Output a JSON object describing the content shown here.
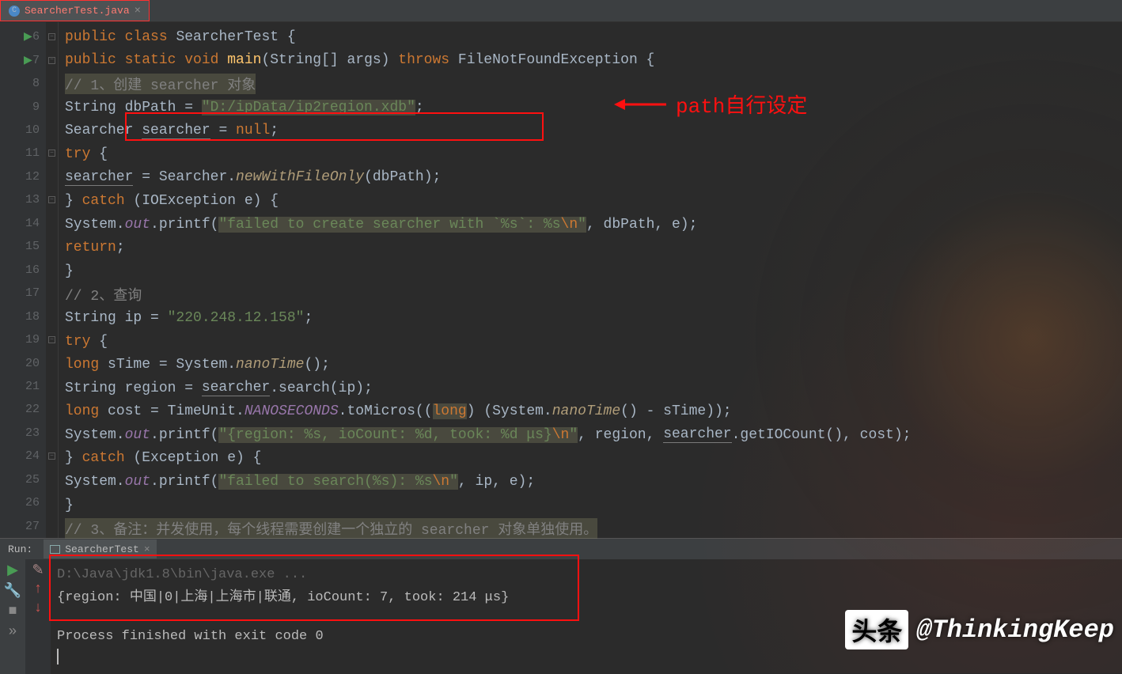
{
  "tab": {
    "filename": "SearcherTest.java"
  },
  "gutter": {
    "lines": [
      "6",
      "7",
      "8",
      "9",
      "10",
      "11",
      "12",
      "13",
      "14",
      "15",
      "16",
      "17",
      "18",
      "19",
      "20",
      "21",
      "22",
      "23",
      "24",
      "25",
      "26",
      "27"
    ]
  },
  "code": {
    "l6": {
      "kw1": "public class ",
      "name": "SearcherTest ",
      "brace": "{"
    },
    "l7": {
      "kw1": "public static void ",
      "fn": "main",
      "args": "(String[] args) ",
      "kw2": "throws ",
      "ex": "FileNotFoundException ",
      "brace": "{"
    },
    "l8": {
      "cmt": "// 1、创建 searcher 对象"
    },
    "l9": {
      "t1": "String dbPath = ",
      "str": "\"D:/ipData/ip2region.xdb\"",
      "semi": ";"
    },
    "l10": {
      "t1": "Searcher ",
      "var": "searcher",
      "t2": " = ",
      "kw": "null",
      "semi": ";"
    },
    "l11": {
      "kw": "try ",
      "brace": "{"
    },
    "l12": {
      "var": "searcher",
      "t1": " = Searcher.",
      "fn": "newWithFileOnly",
      "t2": "(dbPath);"
    },
    "l13": {
      "b1": "} ",
      "kw": "catch ",
      "t1": "(IOException e) {"
    },
    "l14": {
      "t1": "System.",
      "fld": "out",
      "t2": ".printf(",
      "str": "\"failed to create searcher with `%s`: %s",
      "esc": "\\n",
      "strend": "\"",
      "t3": ", dbPath, e);"
    },
    "l15": {
      "kw": "return",
      "semi": ";"
    },
    "l16": {
      "brace": "}"
    },
    "l17": {
      "cmt": "// 2、查询"
    },
    "l18": {
      "t1": "String ip = ",
      "str": "\"220.248.12.158\"",
      "semi": ";"
    },
    "l19": {
      "kw": "try ",
      "brace": "{"
    },
    "l20": {
      "kw": "long ",
      "t1": "sTime = System.",
      "fn": "nanoTime",
      "t2": "();"
    },
    "l21": {
      "t1": "String region = ",
      "var": "searcher",
      "t2": ".search(ip);"
    },
    "l22": {
      "kw1": "long ",
      "t1": "cost = TimeUnit.",
      "fld": "NANOSECONDS",
      "t2": ".toMicros((",
      "kw2": "long",
      "t3": ") (System.",
      "fn": "nanoTime",
      "t4": "() - sTime));"
    },
    "l23": {
      "t1": "System.",
      "fld": "out",
      "t2": ".printf(",
      "str": "\"{region: %s, ioCount: %d, took: %d μs}",
      "esc": "\\n",
      "strend": "\"",
      "t3": ", region, ",
      "var": "searcher",
      "t4": ".getIOCount(), cost);"
    },
    "l24": {
      "b1": "} ",
      "kw": "catch ",
      "t1": "(Exception e) {"
    },
    "l25": {
      "t1": "System.",
      "fld": "out",
      "t2": ".printf(",
      "str": "\"failed to search(%s): %s",
      "esc": "\\n",
      "strend": "\"",
      "t3": ", ip, e);"
    },
    "l26": {
      "brace": "}"
    },
    "l27": {
      "cmt": "// 3、备注：并发使用，每个线程需要创建一个独立的 searcher 对象单独使用。"
    }
  },
  "annotation": {
    "text": "path自行设定"
  },
  "run": {
    "label": "Run:",
    "tab_name": "SearcherTest",
    "console": {
      "line1": "D:\\Java\\jdk1.8\\bin\\java.exe ...",
      "line2": "{region: 中国|0|上海|上海市|联通, ioCount: 7, took: 214 μs}",
      "line3": "",
      "line4": "Process finished with exit code 0"
    }
  },
  "watermark": {
    "prefix": "头条",
    "text": "@ThinkingKeep"
  }
}
